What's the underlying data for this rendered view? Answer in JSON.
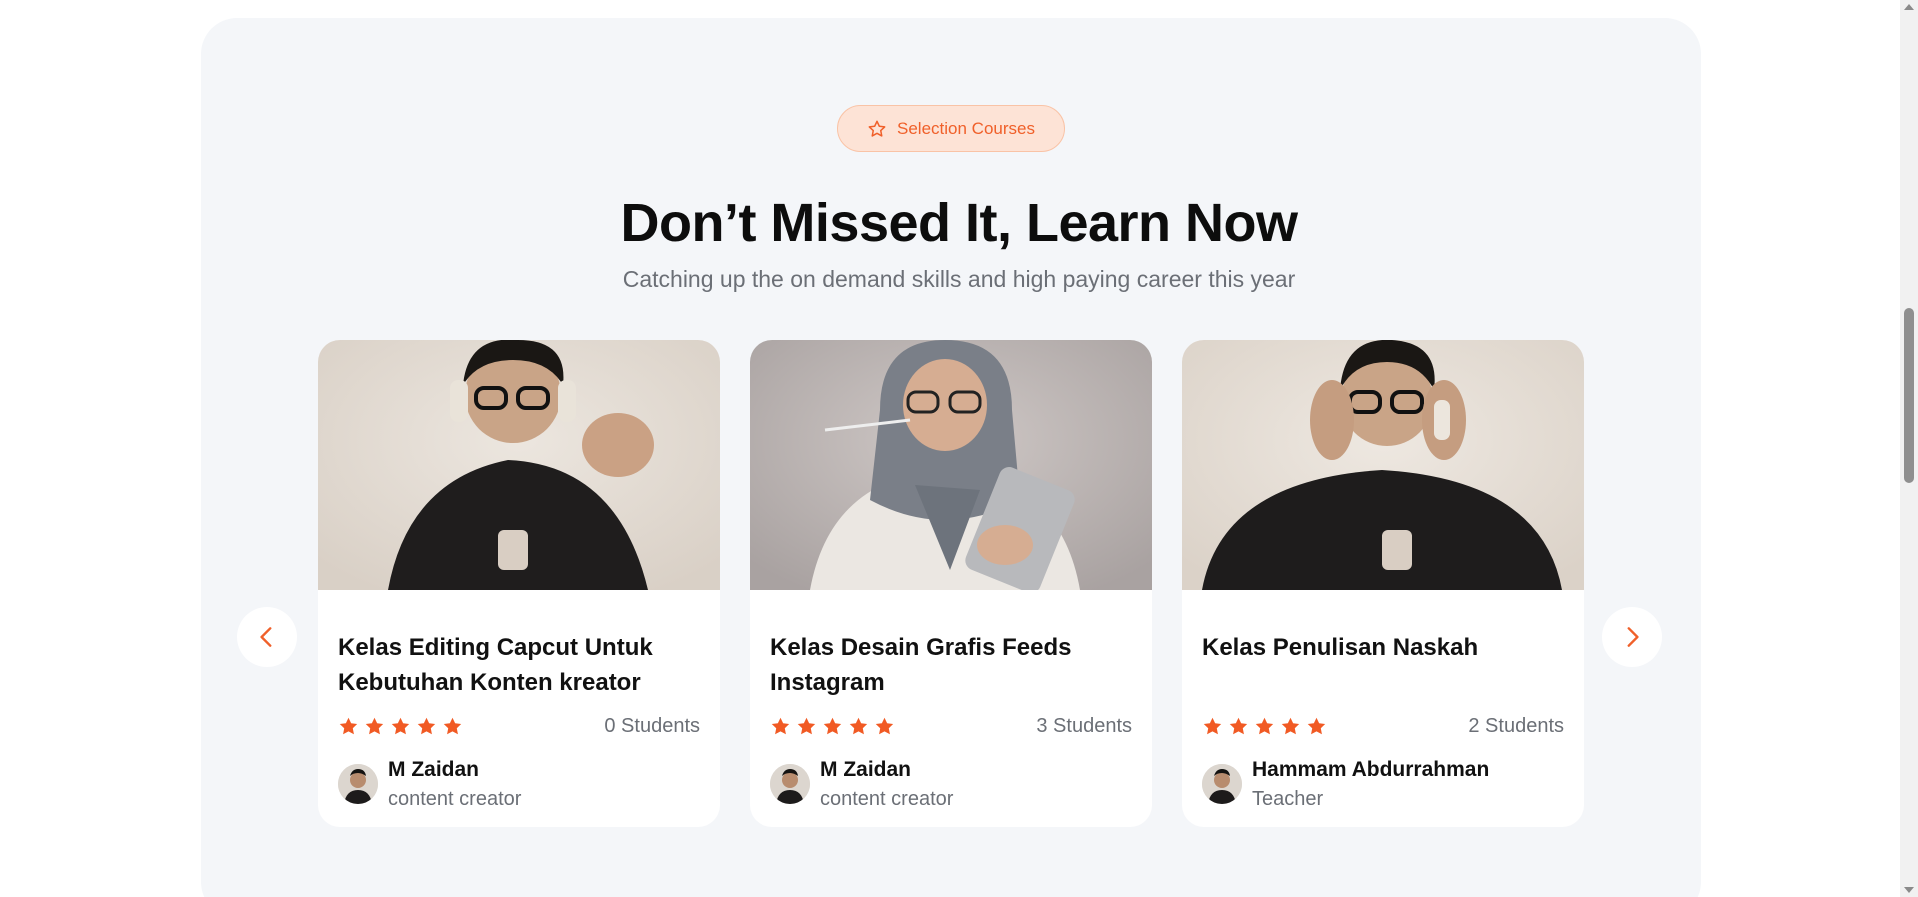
{
  "badge": {
    "label": "Selection Courses",
    "icon": "star-outline-icon"
  },
  "heading": {
    "title": "Don’t Missed It, Learn Now",
    "subtitle": "Catching up the on demand skills and high paying career this year"
  },
  "colors": {
    "accent": "#f0602a",
    "star": "#f15a24",
    "section_bg": "#f4f6f9"
  },
  "nav": {
    "prev_icon": "chevron-left-icon",
    "next_icon": "chevron-right-icon"
  },
  "courses": [
    {
      "title": "Kelas Editing Capcut Untuk Kebutuhan Konten kreator",
      "rating": 5,
      "students": "0 Students",
      "author": "M Zaidan",
      "role": "content creator"
    },
    {
      "title": "Kelas Desain Grafis Feeds Instagram",
      "rating": 5,
      "students": "3 Students",
      "author": "M Zaidan",
      "role": "content creator"
    },
    {
      "title": "Kelas Penulisan Naskah",
      "rating": 5,
      "students": "2 Students",
      "author": "Hammam Abdurrahman",
      "role": "Teacher"
    }
  ]
}
